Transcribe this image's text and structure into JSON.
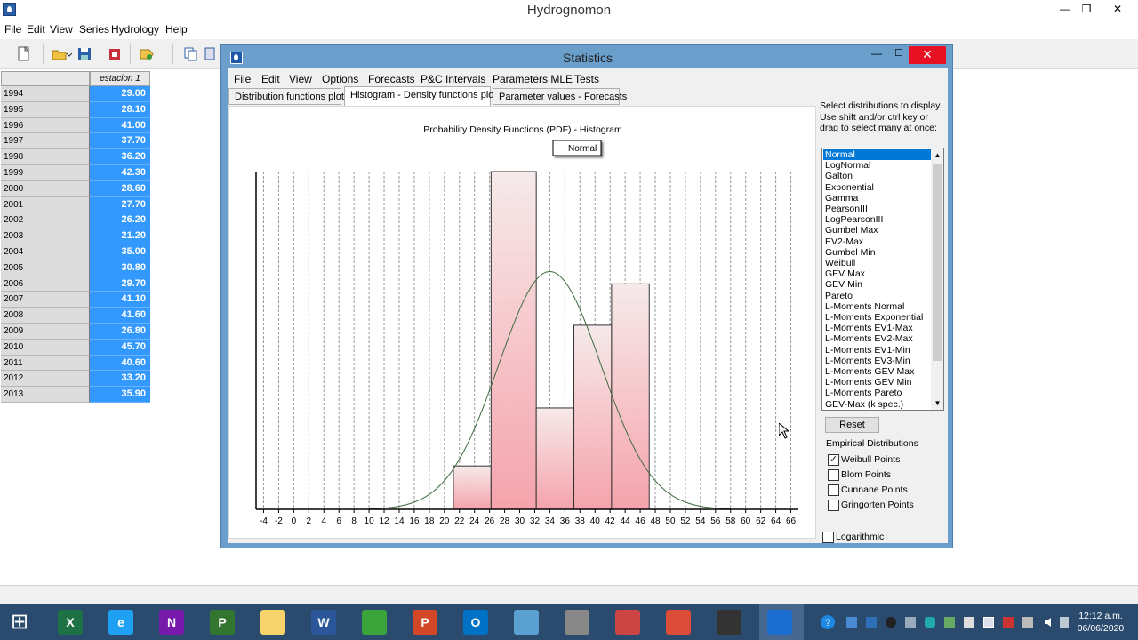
{
  "main": {
    "title": "Hydrognomon",
    "menu": [
      "File",
      "Edit",
      "View",
      "Series",
      "Hydrology",
      "Help"
    ],
    "grid": {
      "column": "estacion 1",
      "rows": [
        {
          "year": "1994",
          "value": "29.00"
        },
        {
          "year": "1995",
          "value": "28.10"
        },
        {
          "year": "1996",
          "value": "41.00"
        },
        {
          "year": "1997",
          "value": "37.70"
        },
        {
          "year": "1998",
          "value": "36.20"
        },
        {
          "year": "1999",
          "value": "42.30"
        },
        {
          "year": "2000",
          "value": "28.60"
        },
        {
          "year": "2001",
          "value": "27.70"
        },
        {
          "year": "2002",
          "value": "26.20"
        },
        {
          "year": "2003",
          "value": "21.20"
        },
        {
          "year": "2004",
          "value": "35.00"
        },
        {
          "year": "2005",
          "value": "30.80"
        },
        {
          "year": "2006",
          "value": "29.70"
        },
        {
          "year": "2007",
          "value": "41.10"
        },
        {
          "year": "2008",
          "value": "41.60"
        },
        {
          "year": "2009",
          "value": "26.80"
        },
        {
          "year": "2010",
          "value": "45.70"
        },
        {
          "year": "2011",
          "value": "40.60"
        },
        {
          "year": "2012",
          "value": "33.20"
        },
        {
          "year": "2013",
          "value": "35.90"
        }
      ]
    }
  },
  "stats": {
    "title": "Statistics",
    "menu": [
      "File",
      "Edit",
      "View",
      "Options",
      "Forecasts",
      "P&C Intervals",
      "Parameters MLE",
      "Tests"
    ],
    "tabs": [
      "Distribution functions plots",
      "Histogram - Density functions plots",
      "Parameter values - Forecasts"
    ],
    "help_text": "Select distributions to display. Use shift and/or ctrl key or drag to select many at once:",
    "distributions": [
      "Normal",
      "LogNormal",
      "Galton",
      "Exponential",
      "Gamma",
      "PearsonIII",
      "LogPearsonIII",
      "Gumbel Max",
      "EV2-Max",
      "Gumbel Min",
      "Weibull",
      "GEV Max",
      "GEV Min",
      "Pareto",
      "L-Moments Normal",
      "L-Moments Exponential",
      "L-Moments EV1-Max",
      "L-Moments EV2-Max",
      "L-Moments EV1-Min",
      "L-Moments EV3-Min",
      "L-Moments GEV Max",
      "L-Moments GEV Min",
      "L-Moments Pareto",
      "GEV-Max (k spec.)"
    ],
    "selected_distribution": "Normal",
    "reset_label": "Reset",
    "empirical_title": "Empirical Distributions",
    "empirical": [
      {
        "label": "Weibull Points",
        "checked": true
      },
      {
        "label": "Blom Points",
        "checked": false
      },
      {
        "label": "Cunnane Points",
        "checked": false
      },
      {
        "label": "Gringorten Points",
        "checked": false
      }
    ],
    "logarithmic": {
      "label": "Logarithmic",
      "checked": false
    }
  },
  "chart_data": {
    "type": "bar",
    "title": "Probability Density Functions (PDF) - Histogram",
    "legend": [
      "Normal"
    ],
    "legend_position": "top",
    "x_ticks": [
      -4,
      -2,
      0,
      2,
      4,
      6,
      8,
      10,
      12,
      14,
      16,
      18,
      20,
      22,
      24,
      26,
      28,
      30,
      32,
      34,
      36,
      38,
      40,
      42,
      44,
      46,
      48,
      50,
      52,
      54,
      56,
      58,
      60,
      62,
      64,
      66
    ],
    "xlim": [
      -5,
      67
    ],
    "histogram": [
      {
        "bin_start": 21.2,
        "bin_end": 26.2,
        "density": 0.0107
      },
      {
        "bin_start": 26.2,
        "bin_end": 32.2,
        "density": 0.0833
      },
      {
        "bin_start": 32.2,
        "bin_end": 37.2,
        "density": 0.025
      },
      {
        "bin_start": 37.2,
        "bin_end": 42.2,
        "density": 0.0454
      },
      {
        "bin_start": 42.2,
        "bin_end": 47.2,
        "density": 0.0556
      }
    ],
    "series": [
      {
        "name": "Normal",
        "type": "line",
        "mean": 34.0,
        "std": 6.8
      }
    ],
    "grid": "vertical dashed",
    "colors": {
      "bars_top": "#f6eaea",
      "bars_bottom": "#f5a3ac",
      "curve": "#3d6b3d"
    }
  },
  "taskbar": {
    "time": "12:12 a.m.",
    "date": "06/06/2020",
    "apps": [
      "windows-start",
      "excel",
      "internet-explorer",
      "onenote",
      "project",
      "file-explorer",
      "word",
      "store",
      "powerpoint",
      "outlook",
      "search-app",
      "app-pro",
      "snipping-tool",
      "chrome",
      "obs",
      "hydrognomon"
    ]
  }
}
